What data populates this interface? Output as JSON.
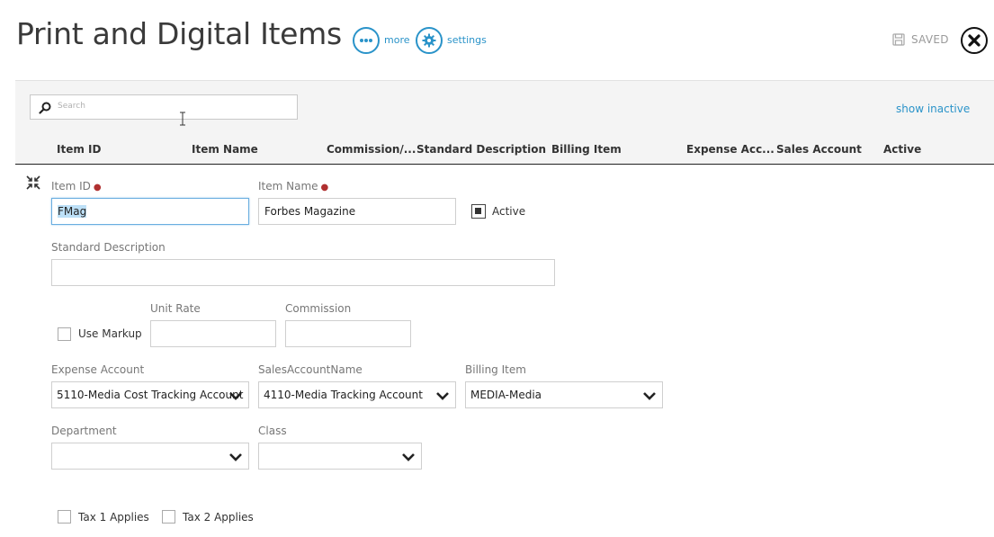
{
  "page": {
    "title": "Print and Digital Items",
    "more_label": "more",
    "settings_label": "settings",
    "saved_label": "SAVED"
  },
  "search": {
    "placeholder": "Search",
    "show_inactive_label": "show inactive"
  },
  "table": {
    "columns": [
      "Item ID",
      "Item Name",
      "Commission/...",
      "Standard Description",
      "Billing Item",
      "Expense Acc...",
      "Sales Account",
      "Active"
    ]
  },
  "form": {
    "item_id": {
      "label": "Item ID",
      "value": "FMag"
    },
    "item_name": {
      "label": "Item Name",
      "value": "Forbes Magazine"
    },
    "active": {
      "label": "Active",
      "checked": true
    },
    "standard_description": {
      "label": "Standard Description",
      "value": ""
    },
    "use_markup": {
      "label": "Use Markup",
      "checked": false
    },
    "unit_rate": {
      "label": "Unit Rate",
      "value": ""
    },
    "commission": {
      "label": "Commission",
      "value": ""
    },
    "expense_account": {
      "label": "Expense Account",
      "value": "5110-Media Cost Tracking Account"
    },
    "sales_account": {
      "label": "SalesAccountName",
      "value": "4110-Media Tracking Account"
    },
    "billing_item": {
      "label": "Billing Item",
      "value": "MEDIA-Media"
    },
    "department": {
      "label": "Department",
      "value": ""
    },
    "class": {
      "label": "Class",
      "value": ""
    },
    "tax1": {
      "label": "Tax 1 Applies",
      "checked": false
    },
    "tax2": {
      "label": "Tax 2 Applies",
      "checked": false
    }
  },
  "icons": {
    "more": "ellipsis-icon",
    "settings": "gear-icon",
    "saved": "save-icon",
    "close": "close-icon",
    "search": "search-icon",
    "collapse": "collapse-icon"
  },
  "colors": {
    "accent": "#2a93c9",
    "required": "#b03030",
    "panel": "#f4f4f4"
  }
}
